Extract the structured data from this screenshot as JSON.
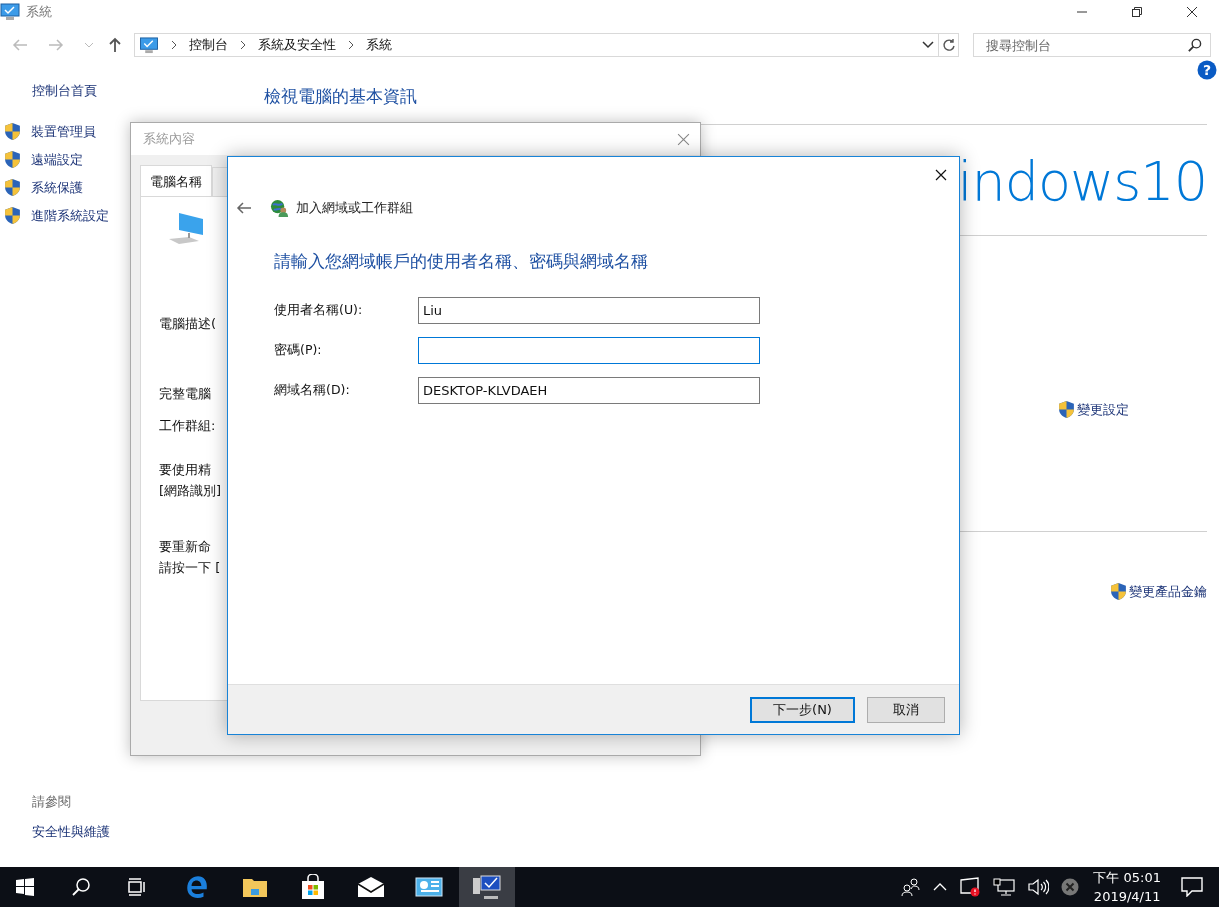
{
  "window": {
    "title": "系統"
  },
  "address_bar": {
    "breadcrumbs": [
      "控制台",
      "系統及安全性",
      "系統"
    ]
  },
  "search": {
    "placeholder": "搜尋控制台"
  },
  "sidebar": {
    "home": "控制台首頁",
    "items": [
      "裝置管理員",
      "遠端設定",
      "系統保護",
      "進階系統設定"
    ],
    "see_also_heading": "請參閱",
    "see_also": [
      "安全性與維護"
    ]
  },
  "content": {
    "heading": "檢視電腦的基本資訊",
    "help": "?",
    "logo_text": "indows10",
    "links": [
      "變更設定",
      "變更產品金鑰"
    ]
  },
  "system_properties": {
    "title": "系統內容",
    "tabs": [
      {
        "label": "電腦名稱",
        "selected": true
      }
    ],
    "blocks": [
      [
        "電腦描述("
      ],
      [
        "完整電腦"
      ],
      [
        "工作群組:"
      ],
      [
        "要使用精",
        "[網路識別]"
      ],
      [
        "要重新命",
        "請按一下 ["
      ]
    ]
  },
  "join_dialog": {
    "title": "加入網域或工作群組",
    "heading": "請輸入您網域帳戶的使用者名稱、密碼與網域名稱",
    "fields": [
      {
        "label": "使用者名稱(U):",
        "value": "Liu",
        "focused": false
      },
      {
        "label": "密碼(P):",
        "focused": true
      },
      {
        "label": "網域名稱(D):",
        "value": "DESKTOP-KLVDAEH",
        "focused": false
      }
    ],
    "buttons": [
      {
        "label": "下一步(N)",
        "default": true
      },
      {
        "label": "取消",
        "default": false
      }
    ]
  },
  "taskbar": {
    "apps": [
      {
        "kind": "edge",
        "selected": false
      },
      {
        "kind": "folder",
        "selected": false
      },
      {
        "kind": "store",
        "selected": false
      },
      {
        "kind": "mail",
        "selected": false
      },
      {
        "kind": "panel",
        "selected": false
      },
      {
        "kind": "system",
        "selected": true
      }
    ],
    "clock": {
      "time": "下午 05:01",
      "date": "2019/4/11"
    }
  }
}
